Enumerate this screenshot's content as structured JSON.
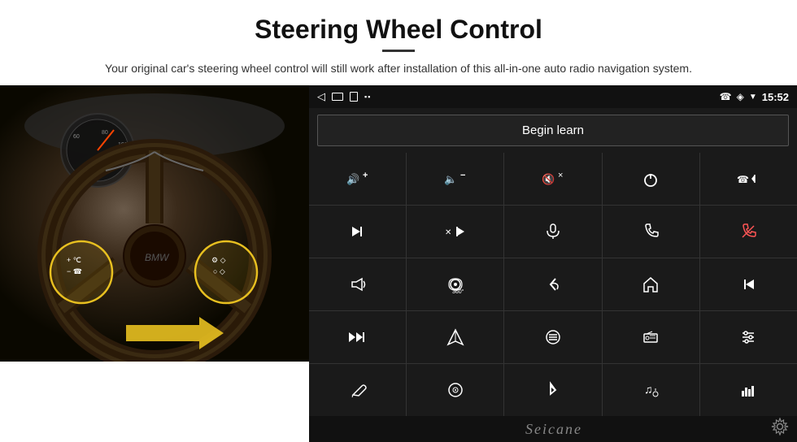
{
  "header": {
    "title": "Steering Wheel Control",
    "subtitle": "Your original car's steering wheel control will still work after installation of this all-in-one auto radio navigation system."
  },
  "status_bar": {
    "back_icon": "◁",
    "home_icon": "□",
    "recent_icon": "□",
    "signal_icon": "▪▪",
    "phone_icon": "☎",
    "location_icon": "◈",
    "wifi_icon": "▼",
    "time": "15:52"
  },
  "begin_learn_label": "Begin learn",
  "controls": [
    {
      "icon": "vol_up_plus",
      "symbol": "🔊+",
      "row": 1,
      "col": 1
    },
    {
      "icon": "vol_down_minus",
      "symbol": "🔈−",
      "row": 1,
      "col": 2
    },
    {
      "icon": "vol_mute",
      "symbol": "🔇×",
      "row": 1,
      "col": 3
    },
    {
      "icon": "power",
      "symbol": "⏻",
      "row": 1,
      "col": 4
    },
    {
      "icon": "phone_prev",
      "symbol": "☎⏮",
      "row": 1,
      "col": 5
    },
    {
      "icon": "next_track",
      "symbol": "⏭",
      "row": 2,
      "col": 1
    },
    {
      "icon": "shuffle",
      "symbol": "⇌⏭",
      "row": 2,
      "col": 2
    },
    {
      "icon": "mic",
      "symbol": "🎤",
      "row": 2,
      "col": 3
    },
    {
      "icon": "phone",
      "symbol": "☎",
      "row": 2,
      "col": 4
    },
    {
      "icon": "hang_up",
      "symbol": "☎↩",
      "row": 2,
      "col": 5
    },
    {
      "icon": "horn",
      "symbol": "📣",
      "row": 3,
      "col": 1
    },
    {
      "icon": "camera_360",
      "symbol": "🔍",
      "row": 3,
      "col": 2
    },
    {
      "icon": "back",
      "symbol": "↩",
      "row": 3,
      "col": 3
    },
    {
      "icon": "home",
      "symbol": "🏠",
      "row": 3,
      "col": 4
    },
    {
      "icon": "prev_track",
      "symbol": "⏮",
      "row": 3,
      "col": 5
    },
    {
      "icon": "fast_forward",
      "symbol": "⏭⏭",
      "row": 4,
      "col": 1
    },
    {
      "icon": "navigate",
      "symbol": "➤",
      "row": 4,
      "col": 2
    },
    {
      "icon": "eq",
      "symbol": "≡",
      "row": 4,
      "col": 3
    },
    {
      "icon": "radio",
      "symbol": "📻",
      "row": 4,
      "col": 4
    },
    {
      "icon": "settings_sliders",
      "symbol": "⚙",
      "row": 4,
      "col": 5
    },
    {
      "icon": "pen",
      "symbol": "✏",
      "row": 5,
      "col": 1
    },
    {
      "icon": "disc",
      "symbol": "💿",
      "row": 5,
      "col": 2
    },
    {
      "icon": "bluetooth",
      "symbol": "⚡",
      "row": 5,
      "col": 3
    },
    {
      "icon": "music_settings",
      "symbol": "♫",
      "row": 5,
      "col": 4
    },
    {
      "icon": "equalizer",
      "symbol": "📊",
      "row": 5,
      "col": 5
    }
  ],
  "bottom": {
    "logo": "Seicane",
    "gear_icon": "⚙"
  }
}
